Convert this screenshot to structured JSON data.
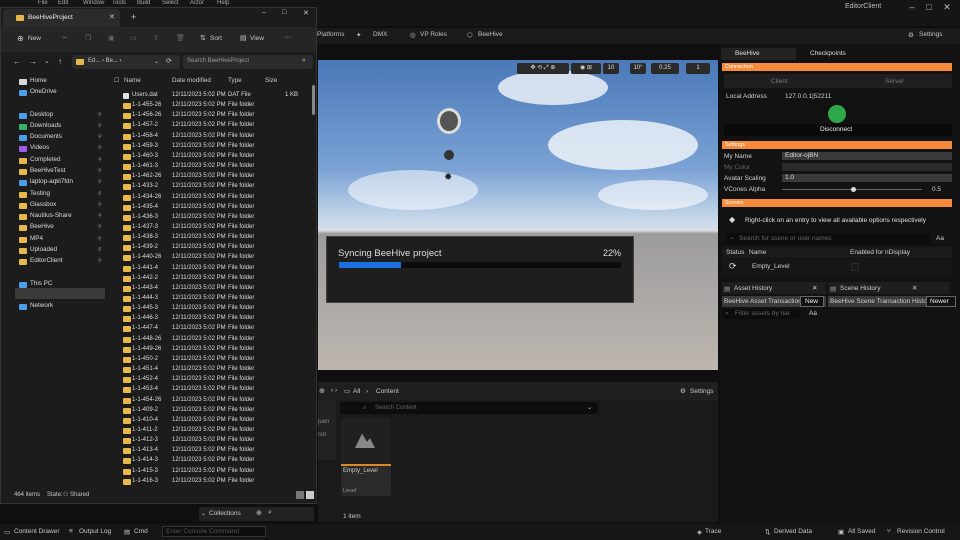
{
  "ue": {
    "menu": [
      "File",
      "Edit",
      "Window",
      "Tools",
      "Build",
      "Select",
      "Actor",
      "Help"
    ],
    "window_title": "EditorClient",
    "toolbar": {
      "platforms": "Platforms",
      "dmx": "DMX",
      "vp_roles": "VP Roles",
      "beehive": "BeeHive",
      "settings": "Settings"
    },
    "viewport_toolbar": {
      "grid": "10",
      "angle": "10°",
      "scale": "0.25",
      "camera": "1"
    },
    "sync": {
      "label": "Syncing BeeHive project",
      "percent": "22%",
      "progress": 0.22
    },
    "content": {
      "breadcrumb_all": "All",
      "breadcrumb_content": "Content",
      "settings": "Settings",
      "search_placeholder": "Search Content",
      "asset_name": "Empty_Level",
      "asset_type": "Level",
      "item_count": "1 item",
      "side_tab1": "juen",
      "side_tab2": "rsh",
      "collections": "Collections"
    },
    "status": {
      "content_drawer": "Content Drawer",
      "output_log": "Output Log",
      "cmd": "Cmd",
      "console_placeholder": "Enter Console Command",
      "trace": "Trace",
      "derived_data": "Derived Data",
      "all_saved": "All Saved",
      "revision_control": "Revision Control"
    }
  },
  "beehive": {
    "tab1": "BeeHive",
    "tab2": "Checkpoints",
    "connection_header": "Connection",
    "client_tab": "Client",
    "server_tab": "Server",
    "local_address_label": "Local Address",
    "local_address": "127.0.0.1|52211",
    "disconnect": "Disconnect",
    "settings_header": "Settings",
    "my_name_label": "My Name",
    "my_name": "Editor-ojBN",
    "my_color_label": "My Color",
    "avatar_scaling_label": "Avatar Scaling",
    "avatar_scaling": "1.0",
    "vcones_label": "VCones Alpha",
    "vcones_value": "0.5",
    "scenes_header": "Scenes",
    "scenes_hint": "Right-click on an entry to view all available options respectively",
    "scene_search_placeholder": "Search for scene or user names",
    "aa": "Aa",
    "col_status": "Status",
    "col_name": "Name",
    "col_ndisplay": "Enabled for nDisplay",
    "scene_name": "Empty_Level",
    "asset_history": "Asset History",
    "scene_history": "Scene History",
    "asset_tx": "BeeHive Asset Transaction",
    "asset_new": "New",
    "scene_tx": "BeeHive Scene Transaction History",
    "scene_newer": "Newer",
    "asset_filter_placeholder": "Filter assets by nar"
  },
  "explorer": {
    "tab_title": "BeeHiveProject",
    "cmd": {
      "new": "New",
      "sort": "Sort",
      "view": "View",
      "more": "···"
    },
    "address": "Ed... › Be... ›",
    "search_placeholder": "Search BeeHiveProject",
    "nav": [
      "Home",
      "OneDrive",
      "Desktop",
      "Downloads",
      "Documents",
      "Videos",
      "Completed",
      "BeeHiveTest",
      "laptop-aqkl7fdn",
      "Testing",
      "Glassbox",
      "Nautilus-Share",
      "BeeHive",
      "MP4",
      "Uploaded",
      "EditorClient",
      "This PC",
      "OS (C:)",
      "Network"
    ],
    "columns": {
      "name": "Name",
      "date": "Date modified",
      "type": "Type",
      "size": "Size"
    },
    "files": [
      {
        "name": "Users.dat",
        "date": "12/11/2023 5:02 PM",
        "type": "DAT File",
        "size": "1 KB"
      },
      {
        "name": "1-1-455-26",
        "date": "12/11/2023 5:02 PM",
        "type": "File folder",
        "size": ""
      },
      {
        "name": "1-1-456-26",
        "date": "12/11/2023 5:02 PM",
        "type": "File folder",
        "size": ""
      },
      {
        "name": "1-1-457-2",
        "date": "12/11/2023 5:02 PM",
        "type": "File folder",
        "size": ""
      },
      {
        "name": "1-1-458-4",
        "date": "12/11/2023 5:02 PM",
        "type": "File folder",
        "size": ""
      },
      {
        "name": "1-1-459-3",
        "date": "12/11/2023 5:02 PM",
        "type": "File folder",
        "size": ""
      },
      {
        "name": "1-1-460-3",
        "date": "12/11/2023 5:02 PM",
        "type": "File folder",
        "size": ""
      },
      {
        "name": "1-1-461-3",
        "date": "12/11/2023 5:02 PM",
        "type": "File folder",
        "size": ""
      },
      {
        "name": "1-1-462-26",
        "date": "12/11/2023 5:02 PM",
        "type": "File folder",
        "size": ""
      },
      {
        "name": "1-1-433-2",
        "date": "12/11/2023 5:02 PM",
        "type": "File folder",
        "size": ""
      },
      {
        "name": "1-1-434-26",
        "date": "12/11/2023 5:02 PM",
        "type": "File folder",
        "size": ""
      },
      {
        "name": "1-1-435-4",
        "date": "12/11/2023 5:02 PM",
        "type": "File folder",
        "size": ""
      },
      {
        "name": "1-1-436-3",
        "date": "12/11/2023 5:02 PM",
        "type": "File folder",
        "size": ""
      },
      {
        "name": "1-1-437-3",
        "date": "12/11/2023 5:02 PM",
        "type": "File folder",
        "size": ""
      },
      {
        "name": "1-1-438-3",
        "date": "12/11/2023 5:02 PM",
        "type": "File folder",
        "size": ""
      },
      {
        "name": "1-1-439-2",
        "date": "12/11/2023 5:02 PM",
        "type": "File folder",
        "size": ""
      },
      {
        "name": "1-1-440-26",
        "date": "12/11/2023 5:02 PM",
        "type": "File folder",
        "size": ""
      },
      {
        "name": "1-1-441-4",
        "date": "12/11/2023 5:02 PM",
        "type": "File folder",
        "size": ""
      },
      {
        "name": "1-1-442-2",
        "date": "12/11/2023 5:02 PM",
        "type": "File folder",
        "size": ""
      },
      {
        "name": "1-1-443-4",
        "date": "12/11/2023 5:02 PM",
        "type": "File folder",
        "size": ""
      },
      {
        "name": "1-1-444-3",
        "date": "12/11/2023 5:02 PM",
        "type": "File folder",
        "size": ""
      },
      {
        "name": "1-1-445-3",
        "date": "12/11/2023 5:02 PM",
        "type": "File folder",
        "size": ""
      },
      {
        "name": "1-1-446-3",
        "date": "12/11/2023 5:02 PM",
        "type": "File folder",
        "size": ""
      },
      {
        "name": "1-1-447-4",
        "date": "12/11/2023 5:02 PM",
        "type": "File folder",
        "size": ""
      },
      {
        "name": "1-1-448-26",
        "date": "12/11/2023 5:02 PM",
        "type": "File folder",
        "size": ""
      },
      {
        "name": "1-1-449-26",
        "date": "12/11/2023 5:02 PM",
        "type": "File folder",
        "size": ""
      },
      {
        "name": "1-1-450-2",
        "date": "12/11/2023 5:02 PM",
        "type": "File folder",
        "size": ""
      },
      {
        "name": "1-1-451-4",
        "date": "12/11/2023 5:02 PM",
        "type": "File folder",
        "size": ""
      },
      {
        "name": "1-1-452-4",
        "date": "12/11/2023 5:02 PM",
        "type": "File folder",
        "size": ""
      },
      {
        "name": "1-1-453-4",
        "date": "12/11/2023 5:02 PM",
        "type": "File folder",
        "size": ""
      },
      {
        "name": "1-1-454-26",
        "date": "12/11/2023 5:02 PM",
        "type": "File folder",
        "size": ""
      },
      {
        "name": "1-1-409-2",
        "date": "12/11/2023 5:02 PM",
        "type": "File folder",
        "size": ""
      },
      {
        "name": "1-1-410-4",
        "date": "12/11/2023 5:02 PM",
        "type": "File folder",
        "size": ""
      },
      {
        "name": "1-1-411-2",
        "date": "12/11/2023 5:02 PM",
        "type": "File folder",
        "size": ""
      },
      {
        "name": "1-1-412-3",
        "date": "12/11/2023 5:02 PM",
        "type": "File folder",
        "size": ""
      },
      {
        "name": "1-1-413-4",
        "date": "12/11/2023 5:02 PM",
        "type": "File folder",
        "size": ""
      },
      {
        "name": "1-1-414-3",
        "date": "12/11/2023 5:02 PM",
        "type": "File folder",
        "size": ""
      },
      {
        "name": "1-1-415-3",
        "date": "12/11/2023 5:02 PM",
        "type": "File folder",
        "size": ""
      },
      {
        "name": "1-1-416-3",
        "date": "12/11/2023 5:02 PM",
        "type": "File folder",
        "size": ""
      }
    ],
    "status_items": "464 items",
    "status_state": "State:",
    "status_shared": "Shared"
  }
}
